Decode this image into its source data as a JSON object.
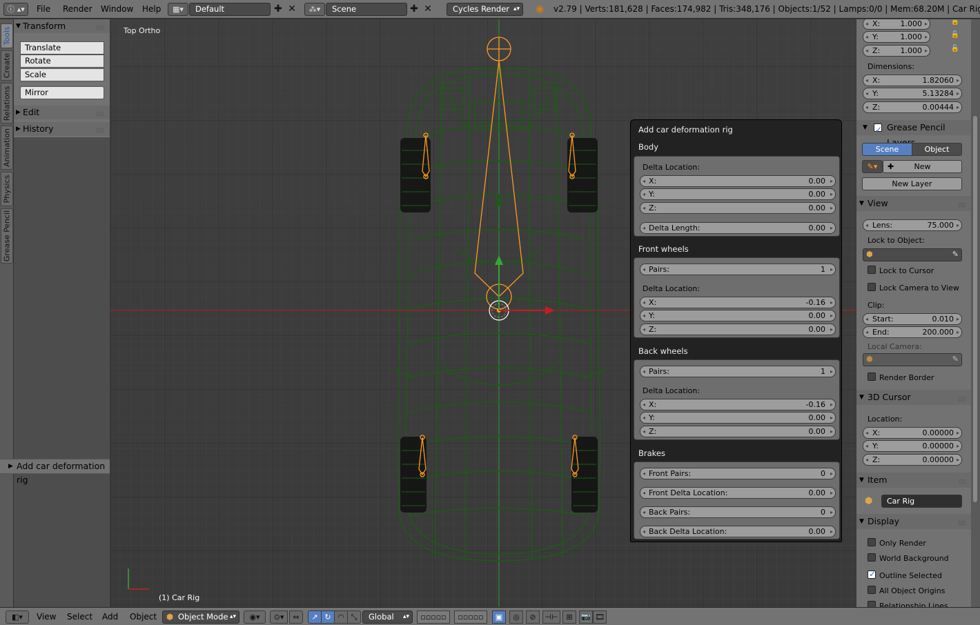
{
  "header": {
    "menus": [
      "File",
      "Render",
      "Window",
      "Help"
    ],
    "screen_layout": "Default",
    "scene": "Scene",
    "render_engine": "Cycles Render",
    "stats": "v2.79 | Verts:181,628 | Faces:174,982 | Tris:348,176 | Objects:1/52 | Lamps:0/0 | Mem:68.20M | Car Rig"
  },
  "left_tabs": [
    "Tools",
    "Create",
    "Relations",
    "Animation",
    "Physics",
    "Grease Pencil"
  ],
  "tools_panel": {
    "transform_title": "Transform",
    "buttons": [
      "Translate",
      "Rotate",
      "Scale"
    ],
    "mirror": "Mirror",
    "edit_title": "Edit",
    "history_title": "History"
  },
  "operator_bar": "Add car deformation rig",
  "viewport": {
    "view_name": "Top Ortho",
    "object_label": "(1) Car Rig"
  },
  "redo_panel": {
    "title": "Add car deformation rig",
    "body": {
      "title": "Body",
      "delta_location_label": "Delta Location:",
      "x": "0.00",
      "y": "0.00",
      "z": "0.00",
      "delta_length_label": "Delta Length:",
      "delta_length": "0.00"
    },
    "front_wheels": {
      "title": "Front wheels",
      "pairs_label": "Pairs:",
      "pairs": "1",
      "delta_location_label": "Delta Location:",
      "x": "-0.16",
      "y": "0.00",
      "z": "0.00"
    },
    "back_wheels": {
      "title": "Back wheels",
      "pairs_label": "Pairs:",
      "pairs": "1",
      "delta_location_label": "Delta Location:",
      "x": "-0.16",
      "y": "0.00",
      "z": "0.00"
    },
    "brakes": {
      "title": "Brakes",
      "front_pairs_label": "Front Pairs:",
      "front_pairs": "0",
      "front_delta_label": "Front Delta Location:",
      "front_delta": "0.00",
      "back_pairs_label": "Back Pairs:",
      "back_pairs": "0",
      "back_delta_label": "Back Delta Location:",
      "back_delta": "0.00"
    }
  },
  "axis_labels": {
    "x": "X:",
    "y": "Y:",
    "z": "Z:"
  },
  "properties": {
    "scale": {
      "x": "1.000",
      "y": "1.000",
      "z": "1.000"
    },
    "dimensions_label": "Dimensions:",
    "dimensions": {
      "x": "1.82060",
      "y": "5.13284",
      "z": "0.00444"
    },
    "grease_pencil": {
      "title": "Grease Pencil Layers",
      "scene_tab": "Scene",
      "object_tab": "Object",
      "new_button": "New",
      "new_layer_button": "New Layer"
    },
    "view": {
      "title": "View",
      "lens_label": "Lens:",
      "lens": "75.000",
      "lock_to_object_label": "Lock to Object:",
      "lock_to_cursor": "Lock to Cursor",
      "lock_camera_to_view": "Lock Camera to View",
      "clip_label": "Clip:",
      "start_label": "Start:",
      "start": "0.010",
      "end_label": "End:",
      "end": "200.000",
      "local_camera_label": "Local Camera:",
      "render_border": "Render Border"
    },
    "cursor": {
      "title": "3D Cursor",
      "location_label": "Location:",
      "x": "0.00000",
      "y": "0.00000",
      "z": "0.00000"
    },
    "item": {
      "title": "Item",
      "name": "Car Rig"
    },
    "display": {
      "title": "Display",
      "only_render": "Only Render",
      "world_background": "World Background",
      "outline_selected": "Outline Selected",
      "all_object_origins": "All Object Origins",
      "relationship_lines": "Relationship Lines"
    }
  },
  "footer": {
    "menus": [
      "View",
      "Select",
      "Add",
      "Object"
    ],
    "mode": "Object Mode",
    "orientation": "Global"
  },
  "colors": {
    "wireframe": "#1a5a12",
    "rig": "#ff9a1f",
    "x_axis": "#b52020",
    "y_axis": "#3aa33a",
    "accent": "#5680c2"
  }
}
